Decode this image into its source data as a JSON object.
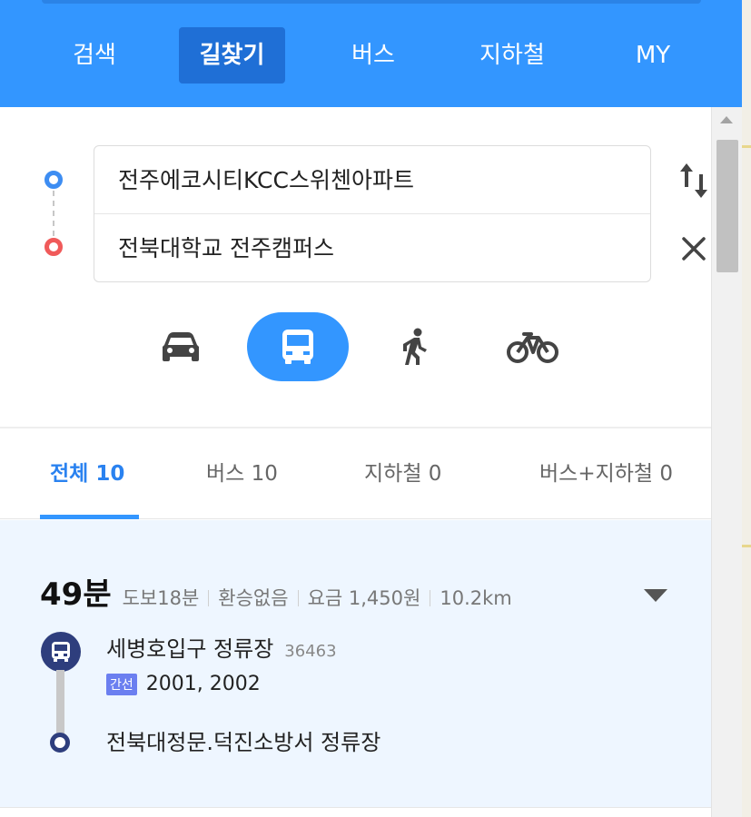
{
  "nav": {
    "tabs": [
      {
        "label": "검색"
      },
      {
        "label": "길찾기"
      },
      {
        "label": "버스"
      },
      {
        "label": "지하철"
      },
      {
        "label": "MY"
      }
    ],
    "active": "길찾기"
  },
  "route": {
    "origin": "전주에코시티KCC스위첸아파트",
    "destination": "전북대학교 전주캠퍼스"
  },
  "modes": [
    "car",
    "bus",
    "walk",
    "bike"
  ],
  "active_mode": "bus",
  "result_tabs": [
    {
      "label": "전체",
      "count": "10"
    },
    {
      "label": "버스",
      "count": "10"
    },
    {
      "label": "지하철",
      "count": "0"
    },
    {
      "label": "버스+지하철",
      "count": "0"
    }
  ],
  "result": {
    "duration": "49분",
    "walk": "도보18분",
    "transfer": "환승없음",
    "fare": "요금 1,450원",
    "distance": "10.2km",
    "board_stop": "세병호입구 정류장",
    "board_stop_id": "36463",
    "line_type": "간선",
    "bus_numbers": "2001, 2002",
    "alight_stop": "전북대정문.덕진소방서 정류장"
  },
  "colors": {
    "brand_blue": "#3396ff",
    "active_tab_bg": "#1f6fd6",
    "bus_line_navy": "#2e3e7d",
    "badge_purple": "#6b7ff0"
  }
}
